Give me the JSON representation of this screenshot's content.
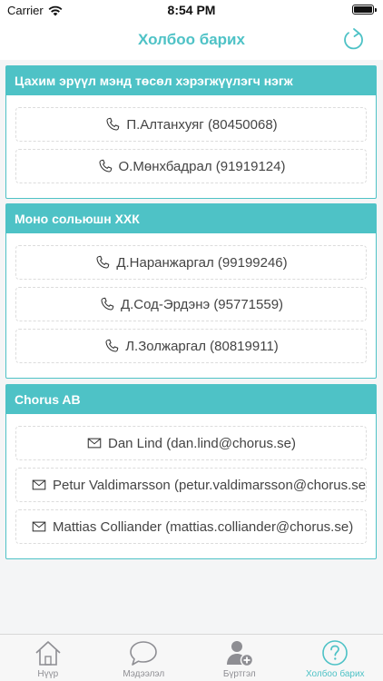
{
  "status_bar": {
    "carrier": "Carrier",
    "time": "8:54 PM"
  },
  "nav": {
    "title": "Холбоо барих",
    "refresh_icon": "refresh-icon"
  },
  "groups": [
    {
      "title": "Цахим эрүүл мэнд төсөл хэрэгжүүлэгч нэгж",
      "contacts": [
        {
          "icon": "phone-icon",
          "text": "П.Алтанхуяг (80450068)"
        },
        {
          "icon": "phone-icon",
          "text": "О.Мөнхбадрал (91919124)"
        }
      ]
    },
    {
      "title": "Моно сольюшн ХХК",
      "contacts": [
        {
          "icon": "phone-icon",
          "text": "Д.Наранжаргал (99199246)"
        },
        {
          "icon": "phone-icon",
          "text": "Д.Сод-Эрдэнэ (95771559)"
        },
        {
          "icon": "phone-icon",
          "text": "Л.Золжаргал (80819911)"
        }
      ]
    },
    {
      "title": "Chorus AB",
      "contacts": [
        {
          "icon": "mail-icon",
          "text": "Dan Lind (dan.lind@chorus.se)"
        },
        {
          "icon": "mail-icon",
          "text": "Petur Valdimarsson (petur.valdimarsson@chorus.se)"
        },
        {
          "icon": "mail-icon",
          "text": "Mattias Colliander (mattias.colliander@chorus.se)"
        }
      ]
    }
  ],
  "tabs": [
    {
      "label": "Нүүр",
      "icon": "home-icon",
      "active": false
    },
    {
      "label": "Мэдээлэл",
      "icon": "chat-bubble-icon",
      "active": false
    },
    {
      "label": "Бүртгэл",
      "icon": "add-user-icon",
      "active": false
    },
    {
      "label": "Холбоо барих",
      "icon": "help-icon",
      "active": true
    }
  ],
  "colors": {
    "accent": "#4ec2c6",
    "tab_inactive": "#8e8e93",
    "background": "#f4f5f6"
  }
}
